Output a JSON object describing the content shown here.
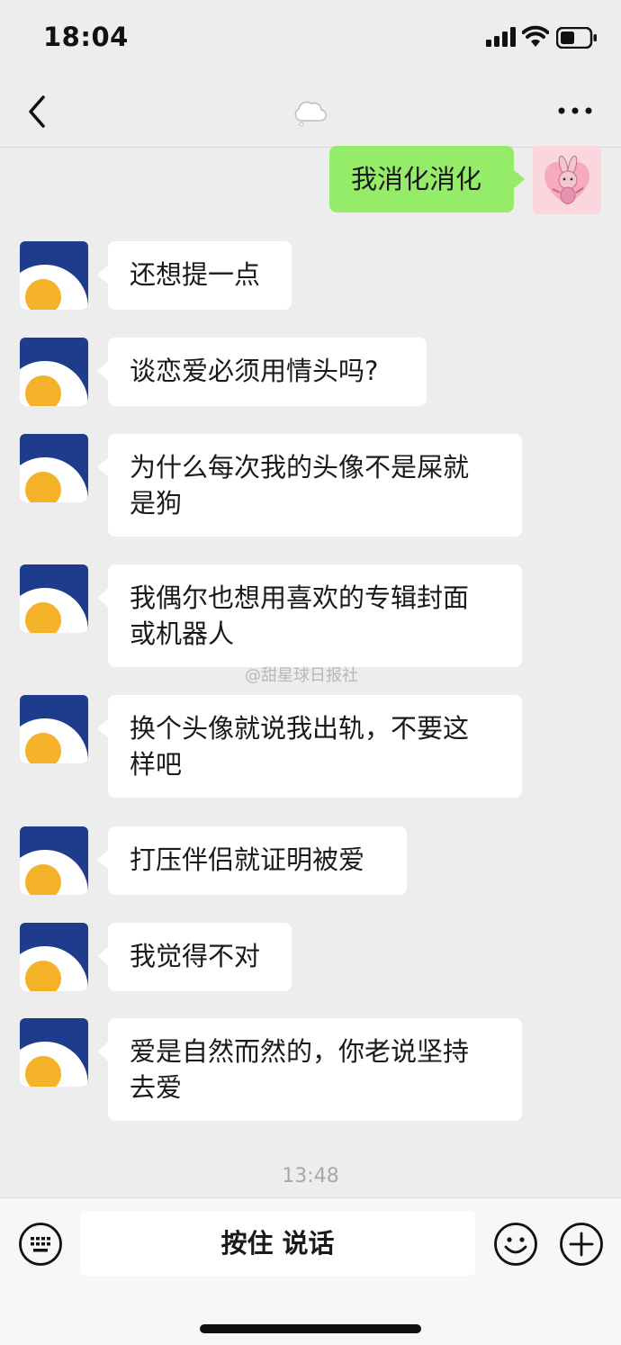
{
  "status_bar": {
    "time": "18:04"
  },
  "nav": {
    "title": "",
    "title_icon": "cloud-icon"
  },
  "messages": [
    {
      "side": "right",
      "text": "我消化消化"
    },
    {
      "side": "left",
      "text": "还想提一点"
    },
    {
      "side": "left",
      "text": "谈恋爱必须用情头吗?"
    },
    {
      "side": "left",
      "line1": "为什么每次我的头像不是屎就",
      "line2": "是狗"
    },
    {
      "side": "left",
      "line1": "我偶尔也想用喜欢的专辑封面",
      "line2": "或机器人"
    },
    {
      "side": "left",
      "line1": "换个头像就说我出轨，不要这",
      "line2": "样吧"
    },
    {
      "side": "left",
      "text": "打压伴侣就证明被爱"
    },
    {
      "side": "left",
      "text": "我觉得不对"
    },
    {
      "side": "left",
      "line1": "爱是自然而然的，你老说坚持",
      "line2": "去爱"
    }
  ],
  "watermark": "@甜星球日报社",
  "timestamp": "13:48",
  "input_bar": {
    "hold_to_talk": "按住 说话"
  },
  "colors": {
    "background": "#ededed",
    "sent_bubble": "#95ec69",
    "received_bubble": "#ffffff",
    "avatar_blue": "#1e3c8c",
    "egg_yolk": "#f3b228"
  }
}
